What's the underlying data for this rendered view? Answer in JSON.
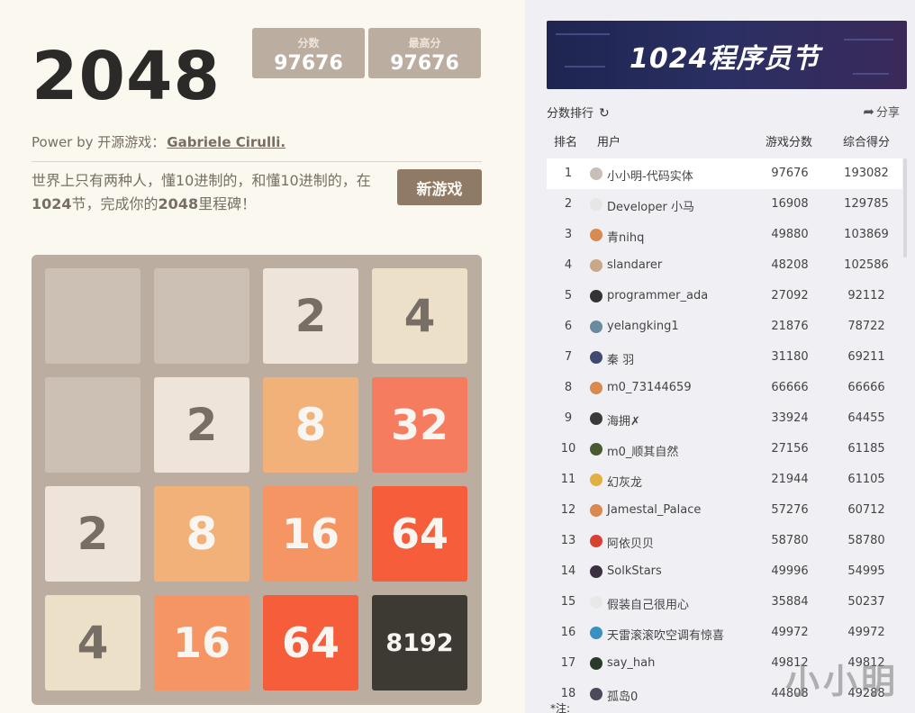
{
  "game": {
    "title": "2048",
    "score_label": "分数",
    "score": "97676",
    "best_label": "最高分",
    "best": "97676",
    "powered_prefix": "Power by 开源游戏：",
    "powered_author": "Gabriele Cirulli.",
    "intro_part1": "世界上只有两种人，懂10进制的，和懂10进制的，在",
    "intro_bold1": "1024",
    "intro_part2": "节，完成你的",
    "intro_bold2": "2048",
    "intro_part3": "里程碑！",
    "new_game": "新游戏",
    "grid": [
      [
        "",
        "",
        "2",
        "4"
      ],
      [
        "",
        "2",
        "8",
        "32"
      ],
      [
        "2",
        "8",
        "16",
        "64"
      ],
      [
        "4",
        "16",
        "64",
        "8192"
      ]
    ]
  },
  "sidebar": {
    "banner_text": "1024程序员节",
    "rank_title": "分数排行",
    "refresh_icon": "↻",
    "share_label": "分享",
    "share_icon": "➦",
    "headers": {
      "rank": "排名",
      "user": "用户",
      "score": "游戏分数",
      "total": "综合得分"
    },
    "rows": [
      {
        "rank": "1",
        "name": "小小明-代码实体",
        "score": "97676",
        "total": "193082",
        "color": "#c8c0b8"
      },
      {
        "rank": "2",
        "name": "Developer 小马",
        "score": "16908",
        "total": "129785",
        "color": "#e6e6e6"
      },
      {
        "rank": "3",
        "name": "青nihq",
        "score": "49880",
        "total": "103869",
        "color": "#d88a50"
      },
      {
        "rank": "4",
        "name": "slandarer",
        "score": "48208",
        "total": "102586",
        "color": "#c8a888"
      },
      {
        "rank": "5",
        "name": "programmer_ada",
        "score": "27092",
        "total": "92112",
        "color": "#333333"
      },
      {
        "rank": "6",
        "name": "yelangking1",
        "score": "21876",
        "total": "78722",
        "color": "#6a8aa0"
      },
      {
        "rank": "7",
        "name": "秦 羽",
        "score": "31180",
        "total": "69211",
        "color": "#404a70"
      },
      {
        "rank": "8",
        "name": "m0_73144659",
        "score": "66666",
        "total": "66666",
        "color": "#d88a50"
      },
      {
        "rank": "9",
        "name": "海拥✗",
        "score": "33924",
        "total": "64455",
        "color": "#3a3a3a"
      },
      {
        "rank": "10",
        "name": "m0_顺其自然",
        "score": "27156",
        "total": "61185",
        "color": "#4a5a30"
      },
      {
        "rank": "11",
        "name": "幻灰龙",
        "score": "21944",
        "total": "61105",
        "color": "#e0b040"
      },
      {
        "rank": "12",
        "name": "Jamestal_Palace",
        "score": "57276",
        "total": "60712",
        "color": "#d88a50"
      },
      {
        "rank": "13",
        "name": "阿依贝贝",
        "score": "58780",
        "total": "58780",
        "color": "#d84030"
      },
      {
        "rank": "14",
        "name": "SolkStars",
        "score": "49996",
        "total": "54995",
        "color": "#3a3040"
      },
      {
        "rank": "15",
        "name": "假装自己很用心",
        "score": "35884",
        "total": "50237",
        "color": "#e8e8e8"
      },
      {
        "rank": "16",
        "name": "天雷滚滚吹空调有惊喜",
        "score": "49972",
        "total": "49972",
        "color": "#3a90c0"
      },
      {
        "rank": "17",
        "name": "say_hah",
        "score": "49812",
        "total": "49812",
        "color": "#2a3a2a"
      },
      {
        "rank": "18",
        "name": "孤岛0",
        "score": "44808",
        "total": "49288",
        "color": "#4a4a5a"
      }
    ],
    "note": "*注:",
    "watermark": "小小明"
  }
}
